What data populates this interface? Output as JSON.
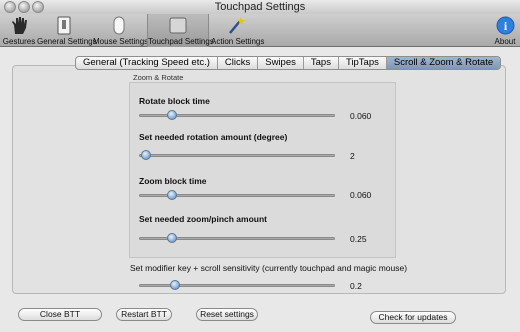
{
  "window": {
    "title": "Touchpad Settings"
  },
  "toolbar": {
    "items": [
      {
        "label": "Gestures",
        "icon": "hand-icon"
      },
      {
        "label": "General Settings",
        "icon": "switch-icon"
      },
      {
        "label": "Mouse Settings",
        "icon": "mouse-icon"
      },
      {
        "label": "Touchpad Settings",
        "icon": "touchpad-icon",
        "selected": true
      },
      {
        "label": "Action Settings",
        "icon": "wand-icon"
      },
      {
        "label": "About",
        "icon": "info-icon"
      }
    ]
  },
  "tabs": [
    {
      "label": "General (Tracking Speed etc.)"
    },
    {
      "label": "Clicks"
    },
    {
      "label": "Swipes"
    },
    {
      "label": "Taps"
    },
    {
      "label": "TipTaps"
    },
    {
      "label": "Scroll & Zoom & Rotate",
      "active": true
    }
  ],
  "group": {
    "title": "Zoom & Rotate",
    "settings": [
      {
        "label": "Rotate block time",
        "value": "0.060",
        "level": 0.14
      },
      {
        "label": "Set needed rotation amount (degree)",
        "value": "2",
        "level": 0.0
      },
      {
        "label": "Zoom block time",
        "value": "0.060",
        "level": 0.14
      },
      {
        "label": "Set needed zoom/pinch amount",
        "value": "0.25",
        "level": 0.14
      }
    ]
  },
  "modifier": {
    "label": "Set modifier key + scroll sensitivity (currently touchpad and magic mouse)",
    "value": "0.2",
    "level": 0.16
  },
  "buttons": {
    "close": "Close BTT",
    "restart": "Restart BTT",
    "reset": "Reset settings",
    "updates": "Check for updates"
  }
}
